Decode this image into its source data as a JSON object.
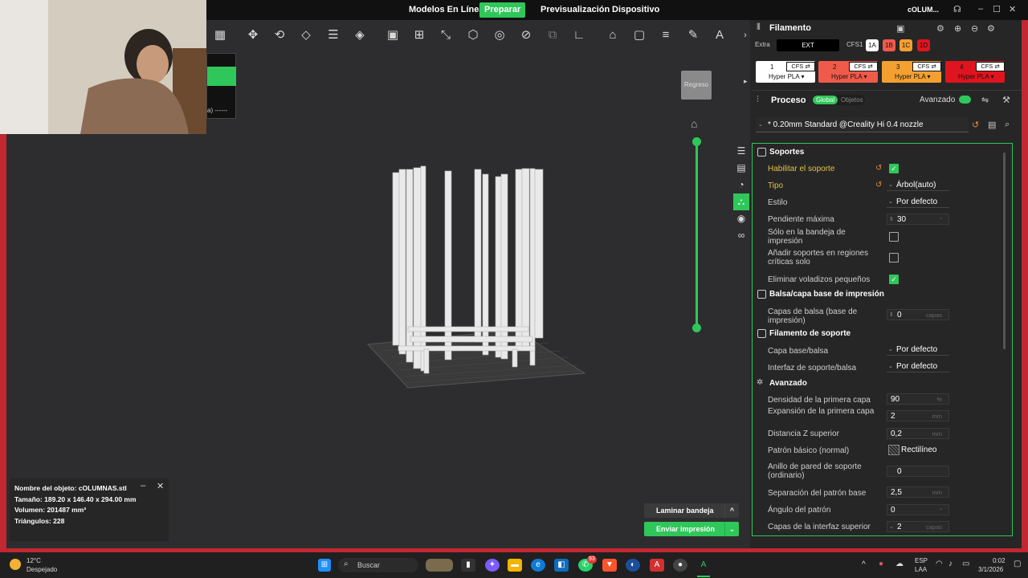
{
  "topbar": {
    "nav": [
      "Modelos En Línea",
      "Preparar",
      "Previsualización",
      "Dispositivo"
    ],
    "active": "Preparar",
    "filename": "cOLUM..."
  },
  "viewport": {
    "viewcube_label": "Regreso",
    "legend_text": "a) ------"
  },
  "object_info": {
    "name": "Nombre del objeto: cOLUMNAS.stl",
    "size": "Tamaño: 189.20 x 146.40 x 294.00 mm",
    "volume": "Volumen: 201487 mm³",
    "triangles": "Triángulos: 228"
  },
  "buttons": {
    "slice": "Laminar bandeja",
    "send": "Enviar impresión"
  },
  "panel": {
    "filament_title": "Filamento",
    "extra_label": "Extra",
    "ext_box": "EXT",
    "cfs_label": "CFS1",
    "slot_chips": [
      {
        "label": "1A",
        "color": "#ffffff"
      },
      {
        "label": "1B",
        "color": "#f05a4a"
      },
      {
        "label": "1C",
        "color": "#f4a030"
      },
      {
        "label": "1D",
        "color": "#e0141e"
      }
    ],
    "filaments": [
      {
        "num": "1",
        "cfs": "CFS ⇄",
        "material": "Hyper PLA ▾",
        "color": "#ffffff"
      },
      {
        "num": "2",
        "cfs": "CFS ⇄",
        "material": "Hyper PLA ▾",
        "color": "#f05a4a"
      },
      {
        "num": "3",
        "cfs": "CFS ⇄",
        "material": "Hyper PLA ▾",
        "color": "#f4a030"
      },
      {
        "num": "4",
        "cfs": "CFS ⇄",
        "material": "Hyper PLA ▾",
        "color": "#e0141e"
      }
    ],
    "process_title": "Proceso",
    "global_toggle": "Global",
    "objects_toggle": "Objetos",
    "advanced_label": "Avanzado",
    "preset": "* 0.20mm Standard @Creality Hi 0.4 nozzle"
  },
  "settings": {
    "sec_supports": "Soportes",
    "enable_support": "Habilitar el soporte",
    "type_label": "Tipo",
    "type_value": "Árbol(auto)",
    "style_label": "Estilo",
    "style_value": "Por defecto",
    "max_slope_label": "Pendiente máxima",
    "max_slope_value": "30",
    "max_slope_unit": "°",
    "only_bed_label": "Sólo en la bandeja de impresión",
    "critical_label": "Añadir soportes en regiones críticas solo",
    "remove_small_label": "Eliminar voladizos pequeños",
    "sec_raft": "Balsa/capa base de impresión",
    "raft_layers_label": "Capas de balsa (base de impresión)",
    "raft_layers_value": "0",
    "raft_layers_unit": "capas",
    "sec_support_fil": "Filamento de soporte",
    "base_label": "Capa base/balsa",
    "base_value": "Por defecto",
    "interface_label": "Interfaz de soporte/balsa",
    "interface_value": "Por defecto",
    "sec_advanced": "Avanzado",
    "first_density_label": "Densidad de la primera capa",
    "first_density_value": "90",
    "first_density_unit": "%",
    "first_exp_label": "Expansión de la primera capa",
    "first_exp_value": "2",
    "first_exp_unit": "mm",
    "top_z_label": "Distancia Z superior",
    "top_z_value": "0,2",
    "top_z_unit": "mm",
    "pattern_label": "Patrón básico (normal)",
    "pattern_value": "Rectilíneo",
    "wall_label": "Anillo de pared de soporte (ordinario)",
    "wall_value": "0",
    "spacing_label": "Separación del patrón base",
    "spacing_value": "2,5",
    "spacing_unit": "mm",
    "angle_label": "Ángulo del patrón",
    "angle_value": "0",
    "angle_unit": "°",
    "top_iface_label": "Capas de la interfaz superior",
    "top_iface_value": "2",
    "top_iface_unit": "capas"
  },
  "taskbar": {
    "weather_temp": "12°C",
    "weather_desc": "Despejado",
    "search": "Buscar",
    "badge": "93",
    "lang": "ESP",
    "lang2": "LAA",
    "time": "0:02",
    "date": "3/1/2026"
  }
}
